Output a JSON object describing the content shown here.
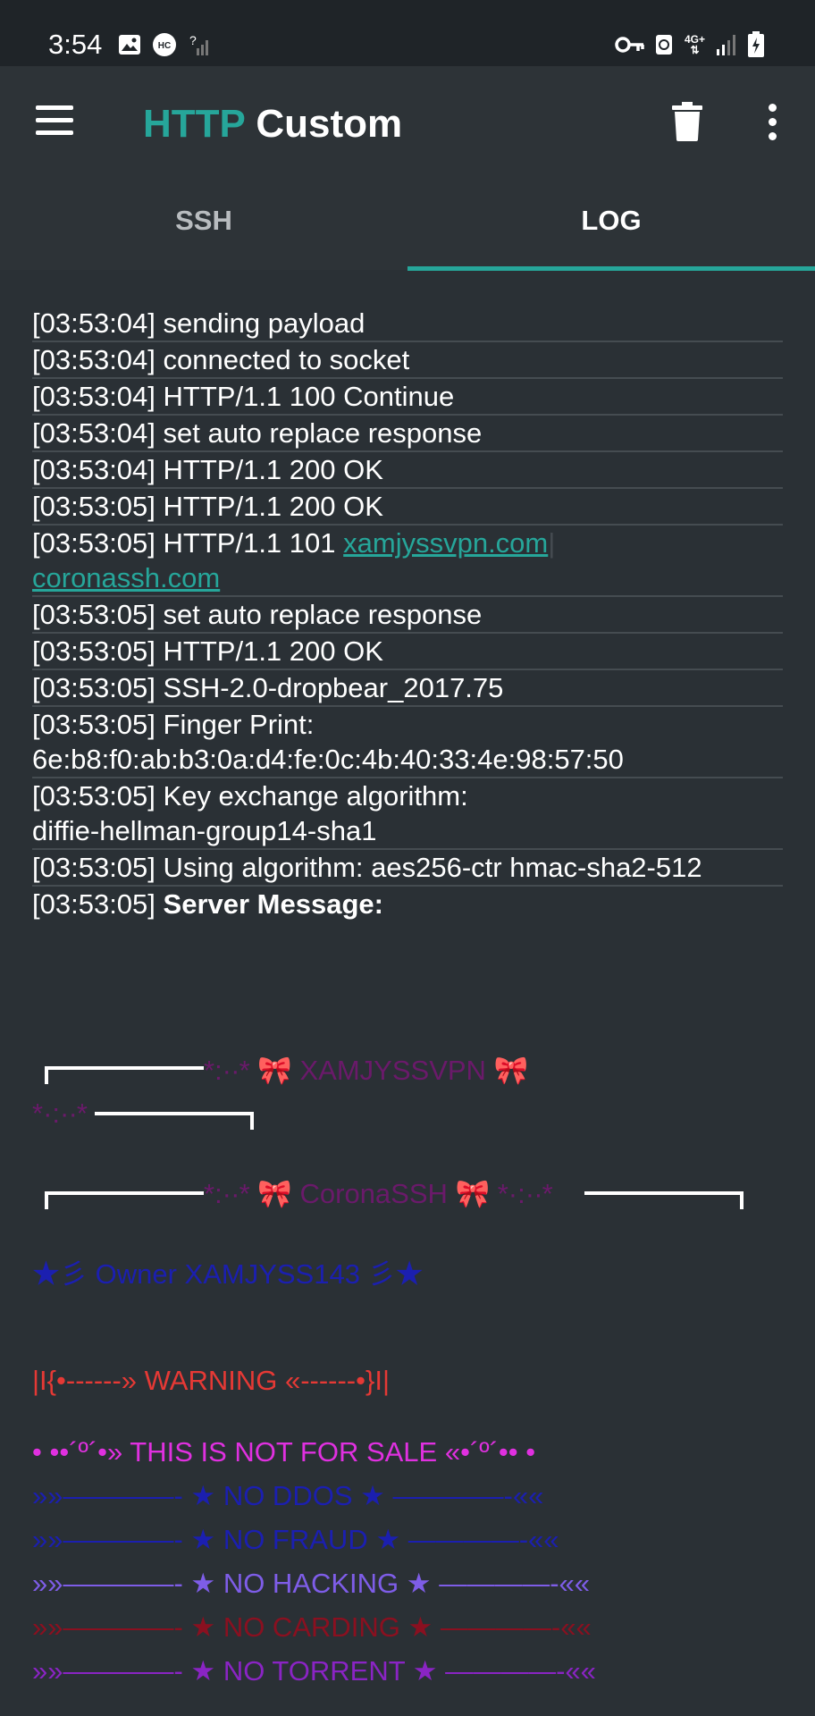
{
  "status_bar": {
    "time": "3:54",
    "icons": [
      "image-icon",
      "hc-icon",
      "signal-weak-icon",
      "vpn-key-icon",
      "recycle-icon",
      "network-4g-icon",
      "signal-icon",
      "battery-charging-icon"
    ],
    "network_label": "4G+"
  },
  "app_bar": {
    "title_part1": "HTTP",
    "title_part2": "Custom",
    "accent_color": "#26a69a"
  },
  "tabs": [
    {
      "label": "SSH",
      "active": false
    },
    {
      "label": "LOG",
      "active": true
    }
  ],
  "log": [
    {
      "time": "[03:53:04]",
      "text": "sending payload"
    },
    {
      "time": "[03:53:04]",
      "text": "connected to socket"
    },
    {
      "time": "[03:53:04]",
      "text": "HTTP/1.1 100 Continue"
    },
    {
      "time": "[03:53:04]",
      "text": "set auto replace response"
    },
    {
      "time": "[03:53:04]",
      "text": "HTTP/1.1 200 OK"
    },
    {
      "time": "[03:53:05]",
      "text": "HTTP/1.1 200 OK"
    },
    {
      "time": "[03:53:05]",
      "text": "HTTP/1.1 101",
      "link1": "xamjyssvpn.com",
      "sep": "|",
      "link2": "coronassh.com"
    },
    {
      "time": "[03:53:05]",
      "text": "set auto replace response"
    },
    {
      "time": "[03:53:05]",
      "text": "HTTP/1.1 200 OK"
    },
    {
      "time": "[03:53:05]",
      "text": "SSH-2.0-dropbear_2017.75"
    },
    {
      "time": "[03:53:05]",
      "text": "Finger Print:",
      "line2": "6e:b8:f0:ab:b3:0a:d4:fe:0c:4b:40:33:4e:98:57:50"
    },
    {
      "time": "[03:53:05]",
      "text": "Key exchange algorithm:",
      "line2": "diffie-hellman-group14-sha1"
    },
    {
      "time": "[03:53:05]",
      "text": "Using algorithm: aes256-ctr hmac-sha2-512"
    },
    {
      "time": "[03:53:05]",
      "bold": "Server Message:"
    }
  ],
  "server_message": {
    "banner1_text": "*:··* 🎀 XAMJYSSVPN 🎀",
    "banner1_tail": "*·:··*",
    "banner2_text": "*:··* 🎀 CoronaSSH 🎀 *·:··*",
    "owner": "★彡 Owner XAMJYSS143 彡★",
    "warning": "|I{•------» WARNING «------•}I|",
    "not_for_sale": "• ••´º´•» THIS IS NOT FOR SALE «•´º´•• •",
    "rules": [
      {
        "text": "»»————- ★ NO DDOS ★ ————-««",
        "color": "#1b1fb0"
      },
      {
        "text": "»»————- ★ NO FRAUD ★ ————-««",
        "color": "#1b1fb0"
      },
      {
        "text": "»»————- ★ NO HACKING ★ ————-««",
        "color": "#7e5de8"
      },
      {
        "text": "»»————- ★ NO CARDING ★ ————-««",
        "color": "#8a1020"
      },
      {
        "text": "»»————- ★ NO TORRENT ★ ————-««",
        "color": "#8a24c4"
      }
    ],
    "colors": {
      "banner": "#6a1a6a",
      "owner": "#1b1fb0",
      "warning": "#e53935",
      "not_for_sale": "#e030e0"
    }
  }
}
